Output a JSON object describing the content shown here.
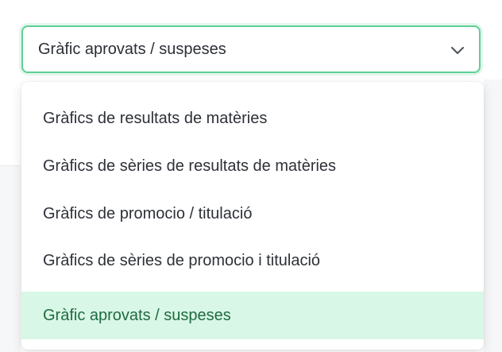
{
  "select": {
    "current_value": "Gràfic aprovats / suspeses",
    "icon": "chevron-down-icon",
    "accent_color": "#5fcf93"
  },
  "dropdown": {
    "options": [
      {
        "label": "Gràfics de resultats de matèries",
        "selected": false
      },
      {
        "label": "Gràfics de sèries de resultats de matèries",
        "selected": false
      },
      {
        "label": "Gràfics de promocio / titulació",
        "selected": false
      },
      {
        "label": "Gràfics de sèries de promocio i titulació",
        "selected": false
      },
      {
        "label": "Gràfic aprovats / suspeses",
        "selected": true
      }
    ],
    "selected_background": "#d9f7e6",
    "selected_text_color": "#1f6b41"
  }
}
